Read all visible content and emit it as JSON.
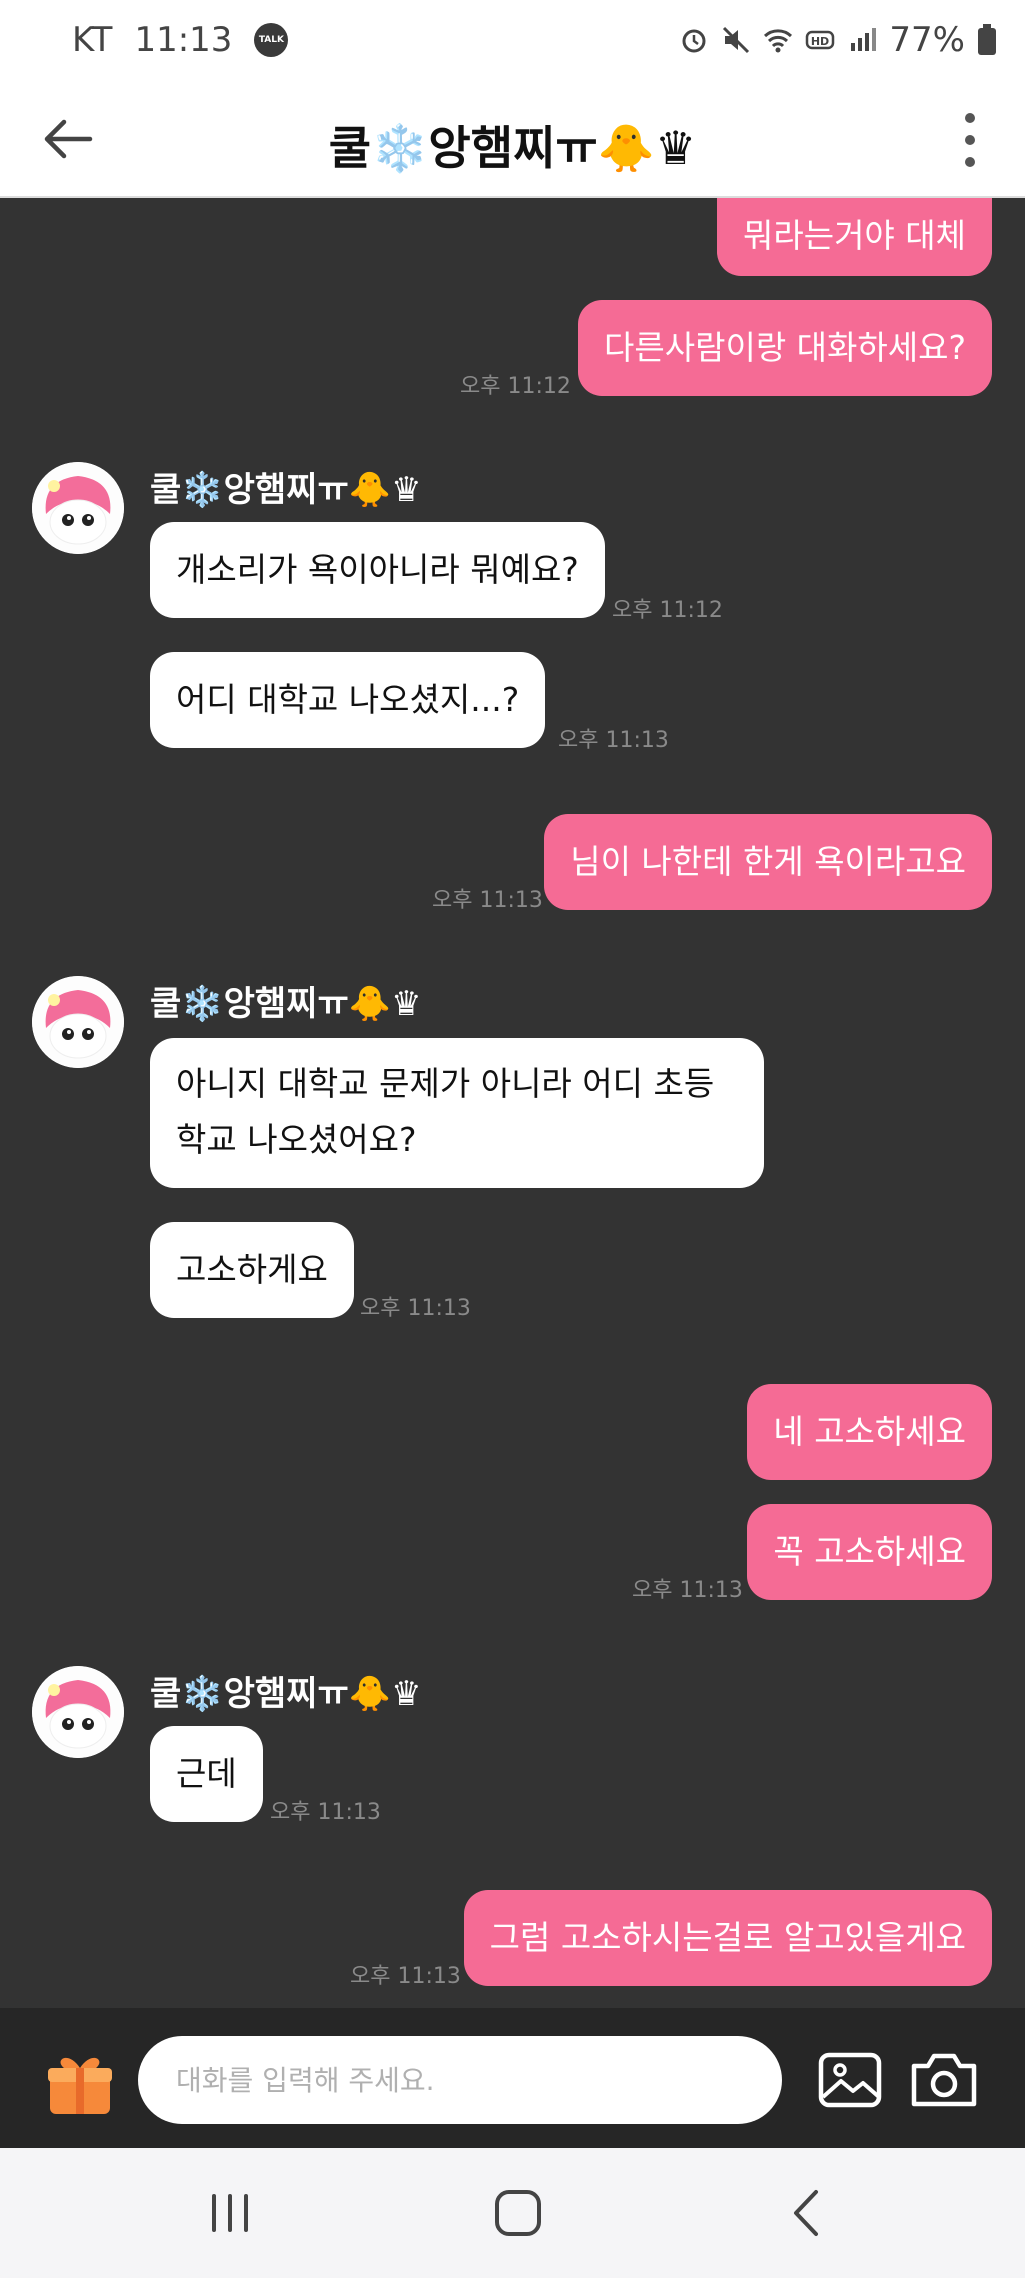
{
  "status_bar": {
    "carrier": "KT",
    "time": "11:13",
    "talk_badge": "TALK",
    "battery": "77%"
  },
  "header": {
    "title": "쿨❄️앙햄찌ㅠ🐥♛"
  },
  "messages": [
    {
      "from": "me",
      "text": "뭐라는거야 대체"
    },
    {
      "from": "me",
      "text": "다른사람이랑 대화하세요?",
      "time": "오후 11:12"
    },
    {
      "from": "them",
      "sender": "쿨❄️앙햄찌ㅠ🐥♛",
      "text": "개소리가 욕이아니라 뭐예요?",
      "time": "오후 11:12"
    },
    {
      "from": "them",
      "text": "어디 대학교 나오셨지...?",
      "time": "오후 11:13"
    },
    {
      "from": "me",
      "text": "님이 나한테 한게 욕이라고요",
      "time": "오후 11:13"
    },
    {
      "from": "them",
      "sender": "쿨❄️앙햄찌ㅠ🐥♛",
      "text": "아니지 대학교 문제가 아니라 어디 초등학교 나오셨어요?"
    },
    {
      "from": "them",
      "text": "고소하게요",
      "time": "오후 11:13"
    },
    {
      "from": "me",
      "text": "네 고소하세요"
    },
    {
      "from": "me",
      "text": "꼭 고소하세요",
      "time": "오후 11:13"
    },
    {
      "from": "them",
      "sender": "쿨❄️앙햄찌ㅠ🐥♛",
      "text": "근데",
      "time": "오후 11:13"
    },
    {
      "from": "me",
      "text": "그럼 고소하시는걸로 알고있을게요",
      "time": "오후 11:13"
    }
  ],
  "input": {
    "placeholder": "대화를 입력해 주세요."
  },
  "colors": {
    "chat_background": "#333333",
    "my_bubble": "#f56b95",
    "their_bubble": "#ffffff",
    "input_bar": "#262626"
  },
  "icons": [
    "arrow-back-icon",
    "more-vertical-icon",
    "gift-icon",
    "image-icon",
    "camera-icon",
    "recent-apps-icon",
    "home-icon",
    "nav-back-icon"
  ]
}
